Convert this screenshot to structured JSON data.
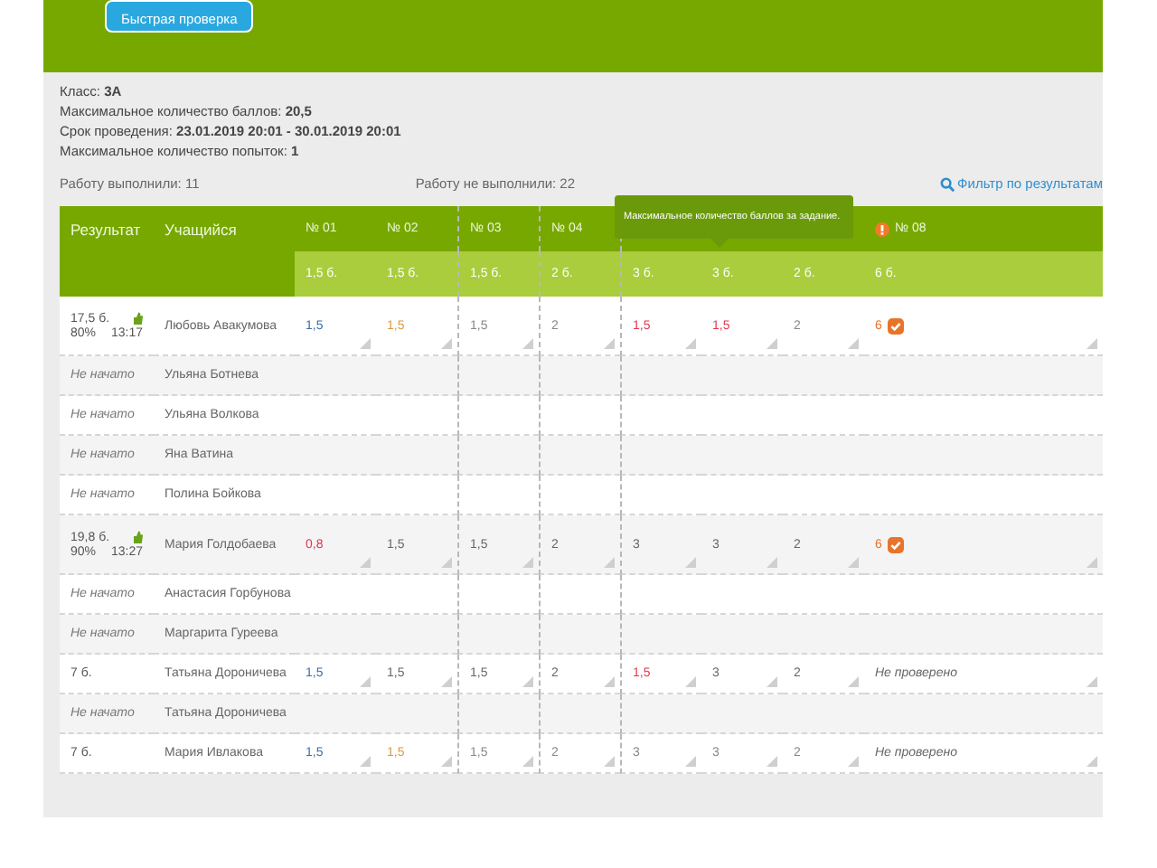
{
  "header": {
    "button": "Быстрая проверка"
  },
  "info": [
    "Класс: **3А**",
    "Максимальное количество баллов: **20,5**",
    "Срок проведения: **23.01.2019 20:01 - 30.01.2019 20:01**",
    "Максимальное количество попыток: **1**"
  ],
  "summary": {
    "done": "Работу выполнили: 11",
    "not_done": "Работу не выполнили: 22",
    "filter": "Фильтр по результатам"
  },
  "table": {
    "columns": [
      "Результат",
      "Учащийся"
    ],
    "tasks": [
      {
        "label": "№ 01",
        "points": "1,5 б.",
        "alert": false
      },
      {
        "label": "№ 02",
        "points": "1,5 б.",
        "alert": false
      },
      {
        "label": "№ 03",
        "points": "1,5 б.",
        "alert": false
      },
      {
        "label": "№ 04",
        "points": "2 б.",
        "alert": false
      },
      {
        "points": "3 б."
      },
      {
        "points": "3 б."
      },
      {
        "points": "2 б."
      },
      {
        "label": "№ 08",
        "points": "6 б.",
        "alert": true
      }
    ],
    "tooltip": "Максимальное количество баллов за задание.",
    "rows": [
      {
        "kind": "result",
        "score": "17,5 б.",
        "percent": "80%",
        "time": "13:17",
        "name": "Любовь Авакумова",
        "cells": [
          {
            "value": "1,5",
            "color": "#3a6ea5"
          },
          {
            "value": "1,5",
            "color": "#d99a40"
          },
          {
            "value": "1,5",
            "color": "#888888"
          },
          {
            "value": "2",
            "color": "#888888"
          },
          {
            "value": "1,5",
            "color": "#e8344e"
          },
          {
            "value": "1,5",
            "color": "#e8344e"
          },
          {
            "value": "2",
            "color": "#888888"
          }
        ],
        "final": {
          "kind": "score",
          "value": "6",
          "verified": true
        }
      },
      {
        "kind": "not_started",
        "status": "Не начато",
        "name": "Ульяна Ботнева"
      },
      {
        "kind": "not_started",
        "status": "Не начато",
        "name": "Ульяна Волкова"
      },
      {
        "kind": "not_started",
        "status": "Не начато",
        "name": "Яна Ватина"
      },
      {
        "kind": "not_started",
        "status": "Не начато",
        "name": "Полина Бойкова"
      },
      {
        "kind": "result",
        "score": "19,8 б.",
        "percent": "90%",
        "time": "13:27",
        "name": "Мария Голдобаева",
        "cells": [
          {
            "value": "0,8",
            "color": "#e8344e"
          },
          {
            "value": "1,5",
            "color": "#666666"
          },
          {
            "value": "1,5",
            "color": "#666666"
          },
          {
            "value": "2",
            "color": "#666666"
          },
          {
            "value": "3",
            "color": "#666666"
          },
          {
            "value": "3",
            "color": "#666666"
          },
          {
            "value": "2",
            "color": "#666666"
          }
        ],
        "final": {
          "kind": "score",
          "value": "6",
          "verified": true
        }
      },
      {
        "kind": "not_started",
        "status": "Не начато",
        "name": "Анастасия Горбунова"
      },
      {
        "kind": "not_started",
        "status": "Не начато",
        "name": "Маргарита Гуреева"
      },
      {
        "kind": "result",
        "score": "7 б.",
        "name": "Татьяна Дороничева",
        "cells": [
          {
            "value": "1,5",
            "color": "#3a6ea5"
          },
          {
            "value": "1,5",
            "color": "#666666"
          },
          {
            "value": "1,5",
            "color": "#666666"
          },
          {
            "value": "2",
            "color": "#666666"
          },
          {
            "value": "1,5",
            "color": "#e8344e"
          },
          {
            "value": "3",
            "color": "#666666"
          },
          {
            "value": "2",
            "color": "#666666"
          }
        ],
        "final": {
          "kind": "note",
          "value": "Не проверено"
        }
      },
      {
        "kind": "not_started",
        "status": "Не начато",
        "name": "Татьяна Дороничева"
      },
      {
        "kind": "result",
        "score": "7 б.",
        "name": "Мария Ивлакова",
        "cells": [
          {
            "value": "1,5",
            "color": "#3a6ea5"
          },
          {
            "value": "1,5",
            "color": "#d99a40"
          },
          {
            "value": "1,5",
            "color": "#888888"
          },
          {
            "value": "2",
            "color": "#888888"
          },
          {
            "value": "3",
            "color": "#888888"
          },
          {
            "value": "3",
            "color": "#888888"
          },
          {
            "value": "2",
            "color": "#888888"
          }
        ],
        "final": {
          "kind": "note",
          "value": "Не проверено"
        }
      }
    ]
  }
}
